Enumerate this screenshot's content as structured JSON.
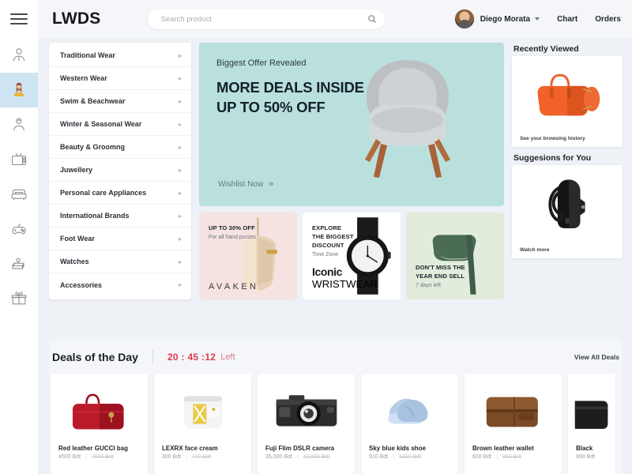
{
  "header": {
    "logo": "LWDS",
    "search_placeholder": "Search product",
    "search_value": "",
    "user_name": "Diego Morata",
    "nav": [
      {
        "label": "Chart"
      },
      {
        "label": "Orders"
      }
    ]
  },
  "rail": {
    "items": [
      {
        "icon": "man-icon",
        "active": false
      },
      {
        "icon": "woman-icon",
        "active": true
      },
      {
        "icon": "kid-icon",
        "active": false
      },
      {
        "icon": "tv-icon",
        "active": false
      },
      {
        "icon": "sofa-icon",
        "active": false
      },
      {
        "icon": "gamepad-icon",
        "active": false
      },
      {
        "icon": "books-icon",
        "active": false
      },
      {
        "icon": "gift-icon",
        "active": false
      }
    ]
  },
  "categories": [
    {
      "label": "Traditional Wear"
    },
    {
      "label": "Western Wear"
    },
    {
      "label": "Swim & Beachwear"
    },
    {
      "label": "Winter & Seasonal Wear"
    },
    {
      "label": "Beauty & Groomng"
    },
    {
      "label": "Juwellery"
    },
    {
      "label": "Personal care Appliances"
    },
    {
      "label": "International Brands"
    },
    {
      "label": "Foot Wear"
    },
    {
      "label": "Watches"
    },
    {
      "label": "Accessories"
    }
  ],
  "hero": {
    "kicker": "Biggest Offer Revealed",
    "line1": "MORE DEALS INSIDE",
    "line2": "UP TO 50% OFF",
    "cta": "Wishlist Now",
    "cta_arrow": "»",
    "bg_color": "#b9e0dd"
  },
  "promos": [
    {
      "head_line1": "UP TO 30% OFF",
      "head_line2": "",
      "head_line3": "",
      "sub": "For all hand purses",
      "brand": "AVAKEN",
      "bg_color": "#f6e3e1"
    },
    {
      "head_line1": "EXPLORE",
      "head_line2": "THE BIGGEST",
      "head_line3": "DISCOUNT",
      "sub": "Time Zone",
      "brand": "Iconic",
      "brand_sub": "WRISTWEAR",
      "bg_color": "#ffffff"
    },
    {
      "head_line1": "DON'T MISS THE",
      "head_line2": "YEAR END SELL",
      "head_line3": "",
      "sub": "7 days left",
      "brand": "",
      "bg_color": "#e2ecdd"
    }
  ],
  "rightbar": {
    "recently_viewed": {
      "title": "Recently Viewed",
      "link": "See your browsing history",
      "item": "orange-handbag"
    },
    "suggestions": {
      "title": "Suggesions for You",
      "link": "Watch more",
      "item": "black-backpack"
    }
  },
  "deals": {
    "title": "Deals of the Day",
    "timer": "20 : 45 :12",
    "timer_suffix": "Left",
    "view_all": "View All Deals",
    "timer_color": "#e1394f",
    "products": [
      {
        "name": "Red leather GUCCI bag",
        "price": "4500 Bdt",
        "old_price": "7500 Bdt",
        "image": "red-handbag"
      },
      {
        "name": "LEXRX face cream",
        "price": "300 Bdt",
        "old_price": "740 Bdt",
        "image": "face-cream-jar"
      },
      {
        "name": "Fuji Flim DSLR camera",
        "price": "35,000 Bdt",
        "old_price": "43,950 Bdt",
        "image": "dslr-camera"
      },
      {
        "name": "Sky blue kids shoe",
        "price": "910 Bdt",
        "old_price": "1390 Bdt",
        "image": "blue-kids-shoe"
      },
      {
        "name": "Brown leather wallet",
        "price": "600 Bdt",
        "old_price": "950 Bdt",
        "image": "brown-wallet"
      },
      {
        "name": "Black",
        "price": "990 Bdt",
        "old_price": "",
        "image": "black-item"
      }
    ]
  }
}
